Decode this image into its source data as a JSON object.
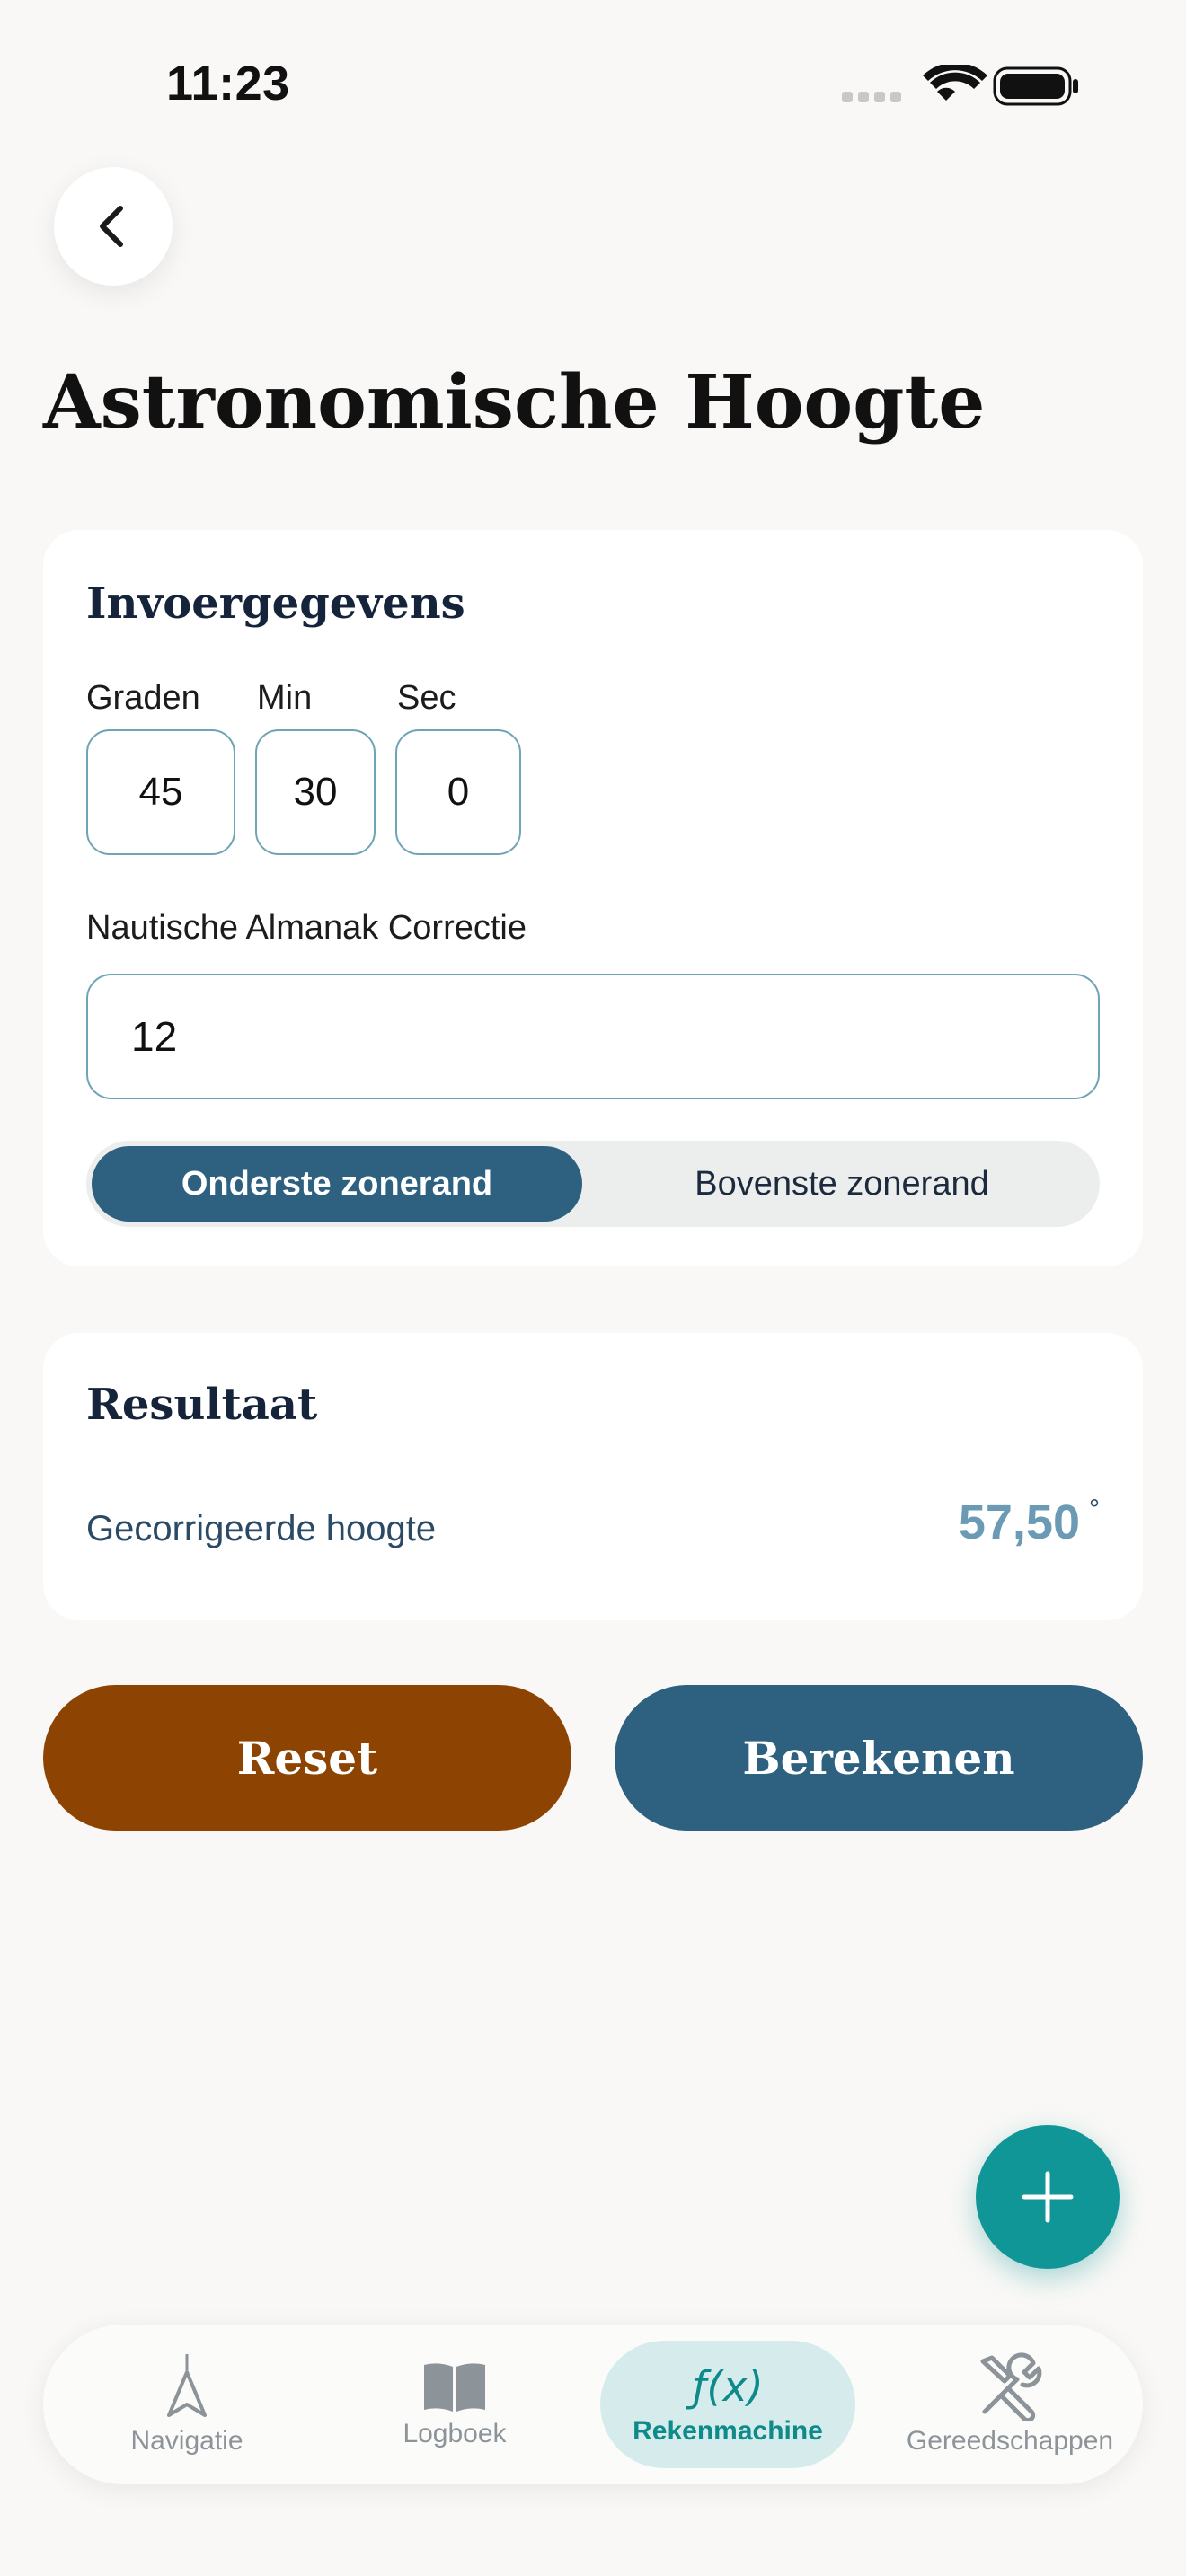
{
  "status_bar": {
    "time": "11:23"
  },
  "header": {
    "title": "Astronomische Hoogte"
  },
  "input_card": {
    "heading": "Invoergegevens",
    "degrees": {
      "label": "Graden",
      "value": "45"
    },
    "minutes": {
      "label": "Min",
      "value": "30"
    },
    "seconds": {
      "label": "Sec",
      "value": "0"
    },
    "correction": {
      "label": "Nautische Almanak Correctie",
      "value": "12"
    },
    "limb_toggle": {
      "options": [
        "Onderste zonerand",
        "Bovenste zonerand"
      ],
      "selected": "Onderste zonerand"
    }
  },
  "result_card": {
    "heading": "Resultaat",
    "label": "Gecorrigeerde hoogte",
    "value": "57,50",
    "unit": "°"
  },
  "actions": {
    "reset_label": "Reset",
    "calculate_label": "Berekenen"
  },
  "fab": {
    "icon": "plus-icon"
  },
  "tab_bar": {
    "items": [
      {
        "label": "Navigatie",
        "icon": "navigation-arrow-icon"
      },
      {
        "label": "Logboek",
        "icon": "open-book-icon"
      },
      {
        "label": "Rekenmachine",
        "icon": "function-icon",
        "glyph": "ƒ(x)"
      },
      {
        "label": "Gereedschappen",
        "icon": "tools-icon"
      }
    ],
    "active": "Rekenmachine"
  },
  "colors": {
    "accent_blue": "#2e6080",
    "reset_brown": "#8d4402",
    "teal": "#109696",
    "result_value": "#6b9bb4"
  }
}
